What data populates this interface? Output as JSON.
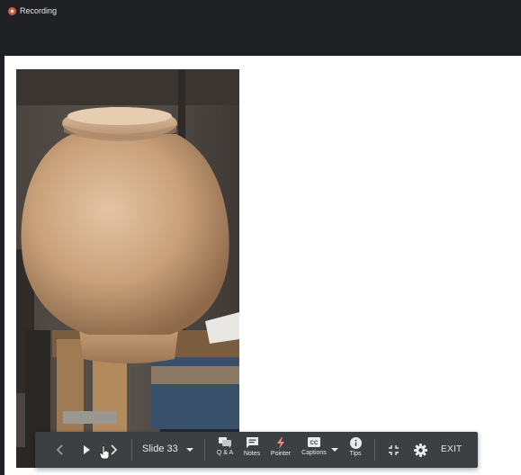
{
  "header": {
    "recording_label": "Recording",
    "recording_color": "#d35f3e"
  },
  "toolbar": {
    "slide_label": "Slide 33",
    "qa_label": "Q & A",
    "notes_label": "Notes",
    "pointer_label": "Pointer",
    "captions_label": "Captions",
    "tips_label": "Tips",
    "exit_label": "EXIT",
    "background": "#3c4043"
  },
  "slide": {
    "image_subject": "wooden-vase-on-workbench"
  }
}
